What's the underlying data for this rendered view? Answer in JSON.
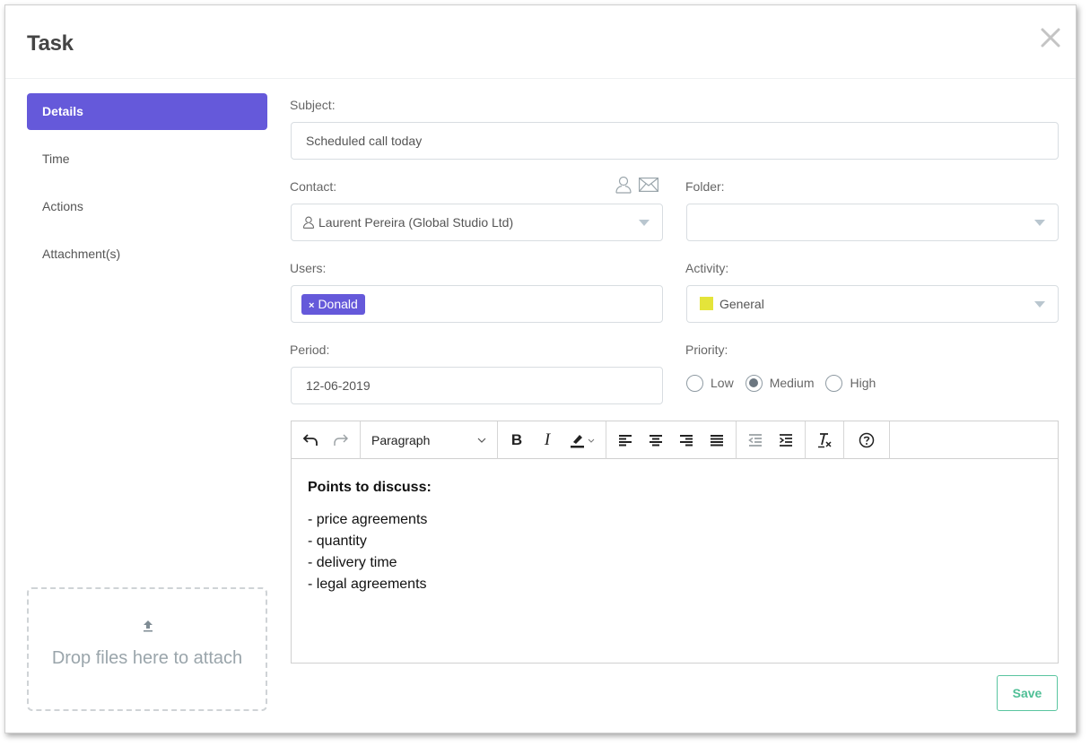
{
  "modal": {
    "title": "Task"
  },
  "sidebar": {
    "items": [
      {
        "label": "Details",
        "active": true
      },
      {
        "label": "Time",
        "active": false
      },
      {
        "label": "Actions",
        "active": false
      },
      {
        "label": "Attachment(s)",
        "active": false
      }
    ],
    "dropzone": {
      "icon": "upload-icon",
      "text": "Drop files here to attach"
    }
  },
  "form": {
    "subject": {
      "label": "Subject:",
      "value": "Scheduled call today"
    },
    "contact": {
      "label": "Contact:",
      "value": "Laurent Pereira (Global Studio Ltd)",
      "icons": [
        "person-icon",
        "envelope-icon"
      ]
    },
    "folder": {
      "label": "Folder:",
      "value": ""
    },
    "users": {
      "label": "Users:",
      "tags": [
        "Donald"
      ],
      "remove_glyph": "×"
    },
    "activity": {
      "label": "Activity:",
      "value": "General",
      "color": "#e4e43a"
    },
    "period": {
      "label": "Period:",
      "value": "12-06-2019"
    },
    "priority": {
      "label": "Priority:",
      "options": [
        "Low",
        "Medium",
        "High"
      ],
      "selected": "Medium"
    }
  },
  "editor": {
    "block_format": "Paragraph",
    "toolbar": [
      "undo",
      "redo",
      "block-format",
      "bold",
      "italic",
      "highlight-color",
      "align-left",
      "align-center",
      "align-right",
      "justify",
      "outdent",
      "indent",
      "clear-formatting",
      "help"
    ],
    "heading": "Points to discuss:",
    "lines": [
      "- price agreements",
      "- quantity",
      "- delivery time",
      "- legal agreements"
    ]
  },
  "footer": {
    "save_label": "Save"
  },
  "colors": {
    "accent": "#6559da",
    "save": "#4fbf96"
  }
}
